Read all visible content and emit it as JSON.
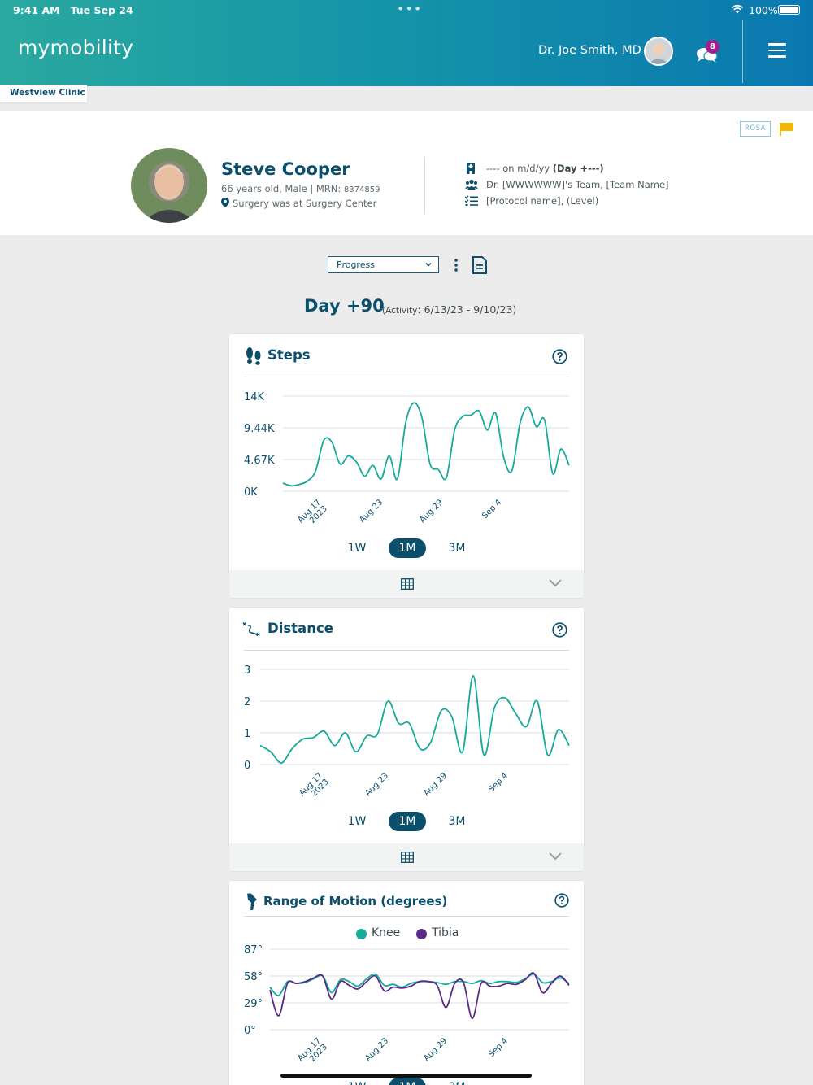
{
  "status_bar": {
    "time": "9:41 AM",
    "date": "Tue Sep 24",
    "battery": "100%"
  },
  "header": {
    "logo": "mymobility",
    "doctor_name": "Dr. Joe Smith, MD",
    "message_count": "8",
    "clinic": "Westview Clinic"
  },
  "patient": {
    "name": "Steve Cooper",
    "meta": "66 years old, Male | MRN: ",
    "mrn": "8374859",
    "location": "Surgery was at Surgery Center",
    "badge": "ROSA",
    "surgery_info": "---- on m/d/yy ",
    "surgery_day": "(Day +---)",
    "team": "Dr. [WWWWWW]'s Team, [Team Name]",
    "protocol": "[Protocol name], (Level)"
  },
  "controls": {
    "view_select": "Progress"
  },
  "day": {
    "title": "Day +90",
    "activity_label": "(Activity",
    "range": "6/13/23 - 9/10/23)"
  },
  "range_buttons": [
    "1W",
    "1M",
    "3M"
  ],
  "active_range": "1M",
  "colors": {
    "teal": "#17a99a",
    "purple": "#5b2a86",
    "navy": "#0b4f6c",
    "flag": "#f2b705",
    "badge": "#a2208e"
  },
  "cards": {
    "steps": {
      "title": "Steps",
      "icon": "footsteps-icon"
    },
    "distance": {
      "title": "Distance",
      "icon": "route-icon"
    },
    "rom": {
      "title": "Range of Motion (degrees)",
      "icon": "knee-icon"
    }
  },
  "chart_data": [
    {
      "type": "line",
      "title": "Steps",
      "x_ticks": [
        [
          "Aug 17",
          "2023"
        ],
        [
          "Aug 23"
        ],
        [
          "Aug 29"
        ],
        [
          "Sep 4"
        ]
      ],
      "y_ticks": [
        "14K",
        "9.44K",
        "4.67K",
        "0K"
      ],
      "ylim": [
        0,
        14000
      ],
      "series": [
        {
          "color": "#17a99a",
          "values": [
            1200,
            800,
            1000,
            1500,
            3000,
            7500,
            7200,
            4000,
            5200,
            4300,
            2200,
            3800,
            1800,
            5200,
            1800,
            10000,
            13000,
            10800,
            4000,
            3200,
            2000,
            9000,
            11000,
            11200,
            11800,
            9000,
            11500,
            5000,
            3000,
            10000,
            12400,
            9500,
            10500,
            2600,
            6200,
            3800
          ]
        }
      ]
    },
    {
      "type": "line",
      "title": "Distance",
      "x_ticks": [
        [
          "Aug 17",
          "2023"
        ],
        [
          "Aug 23"
        ],
        [
          "Aug 29"
        ],
        [
          "Sep 4"
        ]
      ],
      "y_ticks": [
        "3",
        "2",
        "1",
        "0"
      ],
      "ylim": [
        0,
        3
      ],
      "series": [
        {
          "color": "#17a99a",
          "values": [
            0.6,
            0.4,
            0.05,
            0.5,
            0.8,
            0.85,
            1.05,
            0.6,
            1.0,
            0.4,
            0.9,
            0.95,
            2.0,
            1.3,
            1.3,
            0.5,
            0.7,
            1.7,
            1.5,
            0.4,
            2.8,
            0.3,
            1.8,
            2.1,
            1.6,
            1.2,
            2.0,
            0.3,
            1.1,
            0.6
          ]
        }
      ]
    },
    {
      "type": "line",
      "title": "Range of Motion (degrees)",
      "x_ticks": [
        [
          "Aug 17",
          "2023"
        ],
        [
          "Aug 23"
        ],
        [
          "Aug 29"
        ],
        [
          "Sep 4"
        ]
      ],
      "y_ticks": [
        "87°",
        "58°",
        "29°",
        "0°"
      ],
      "ylim": [
        0,
        87
      ],
      "series": [
        {
          "name": "Knee",
          "color": "#17a99a",
          "values": [
            46,
            37,
            52,
            50,
            51,
            55,
            58,
            40,
            54,
            52,
            47,
            55,
            60,
            48,
            49,
            46,
            50,
            52,
            52,
            51,
            49,
            52,
            52,
            50,
            53,
            50,
            52,
            52,
            51,
            55,
            60,
            51,
            52,
            56,
            50
          ]
        },
        {
          "name": "Tibia",
          "color": "#5b2a86",
          "values": [
            43,
            15,
            50,
            50,
            52,
            56,
            58,
            33,
            52,
            48,
            44,
            52,
            58,
            42,
            46,
            45,
            47,
            52,
            52,
            48,
            24,
            50,
            51,
            12,
            50,
            47,
            47,
            50,
            49,
            54,
            61,
            40,
            50,
            58,
            48
          ]
        }
      ]
    }
  ]
}
